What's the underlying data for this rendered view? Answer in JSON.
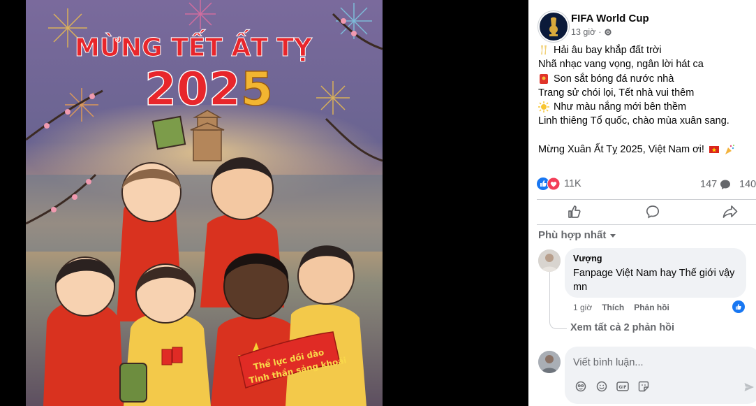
{
  "photo": {
    "title": "MỪNG TẾT ẤT TỴ",
    "year_digits": "202",
    "year_last": "5",
    "banner_line1": "Thể lực dồi dào",
    "banner_line2": "Tinh thần sảng khoái"
  },
  "post": {
    "author": "FIFA World Cup",
    "time": "13 giờ",
    "privacy_icon": "gear-icon",
    "lines": [
      {
        "emoji": "champagne-emoji",
        "text": "Hải âu bay khắp đất trời"
      },
      {
        "emoji": "",
        "text": "Nhã nhạc vang vọng, ngân lời hát ca"
      },
      {
        "emoji": "red-envelope-emoji",
        "text": "Son sắt bóng đá nước nhà"
      },
      {
        "emoji": "",
        "text": "Trang sử chói lọi, Tết nhà vui thêm"
      },
      {
        "emoji": "sun-emoji",
        "text": "Như màu nắng mới bên thềm"
      },
      {
        "emoji": "",
        "text": "Linh thiêng Tổ quốc, chào mùa xuân sang."
      }
    ],
    "closing": "Mừng Xuân Ất Tỵ 2025, Việt Nam ơi!",
    "closing_emojis": [
      "vietnam-flag-emoji",
      "party-popper-emoji"
    ]
  },
  "stats": {
    "reactions": "11K",
    "comments": "147",
    "shares": "140"
  },
  "actions": {
    "like_icon": "thumbs-up-icon",
    "comment_icon": "comment-bubble-icon",
    "share_icon": "share-arrow-icon"
  },
  "comments": {
    "sort_label": "Phù hợp nhất",
    "items": [
      {
        "author": "Vượng",
        "text": "Fanpage Việt Nam hay Thế giới vậy mn",
        "time": "1 giờ",
        "like_label": "Thích",
        "reply_label": "Phản hồi"
      }
    ],
    "view_replies": "Xem tất cả 2 phản hồi"
  },
  "composer": {
    "placeholder": "Viết bình luận...",
    "tools": [
      "avatar-sticker-icon",
      "emoji-icon",
      "gif-icon",
      "sticker-icon"
    ],
    "send_icon": "send-icon"
  },
  "colors": {
    "facebook_blue": "#1877f2",
    "love_red": "#f33e58",
    "muted_text": "#65676b",
    "title_red": "#e8262b"
  }
}
